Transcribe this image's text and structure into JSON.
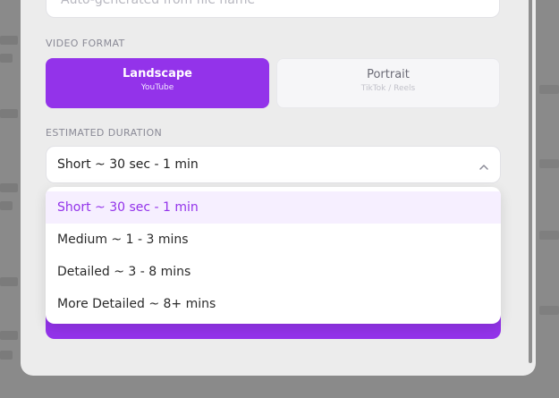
{
  "form": {
    "name_placeholder": "Auto-generated from file name",
    "video_format_label": "VIDEO FORMAT",
    "formats": [
      {
        "title": "Landscape",
        "subtitle": "YouTube",
        "selected": true
      },
      {
        "title": "Portrait",
        "subtitle": "TikTok / Reels",
        "selected": false
      }
    ],
    "duration_label": "ESTIMATED DURATION",
    "duration_value": "Short ~ 30 sec - 1 min",
    "duration_options": [
      {
        "label": "Short ~ 30 sec - 1 min",
        "selected": true
      },
      {
        "label": "Medium ~ 1 - 3 mins",
        "selected": false
      },
      {
        "label": "Detailed ~ 3 - 8 mins",
        "selected": false
      },
      {
        "label": "More Detailed ~ 8+ mins",
        "selected": false
      }
    ]
  },
  "colors": {
    "accent": "#9333ea",
    "overlay": "#8a8a8a",
    "modal_bg": "#ececec"
  },
  "icons": {
    "select_chevron": "chevron-up-icon"
  }
}
